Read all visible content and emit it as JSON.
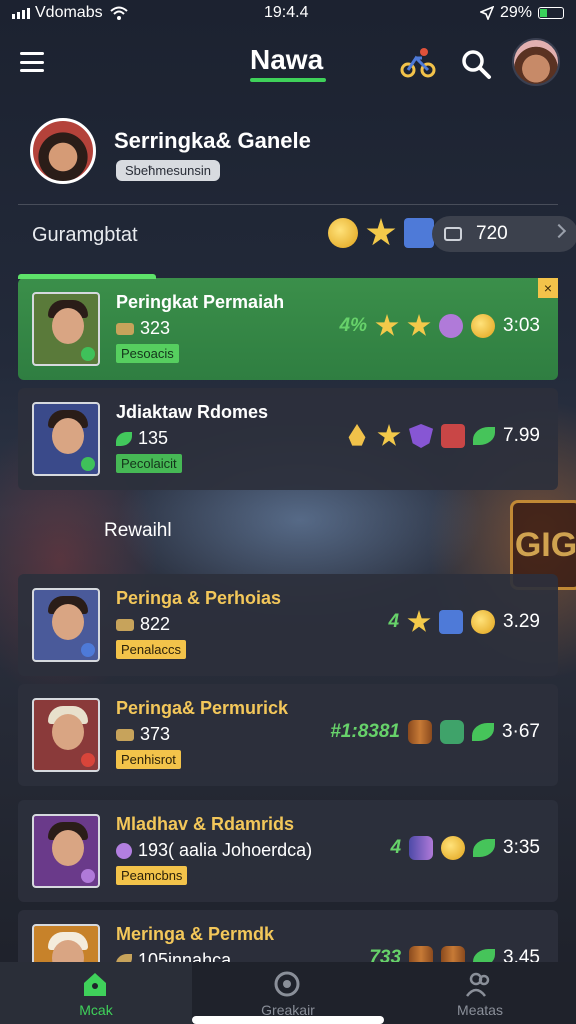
{
  "status_bar": {
    "carrier": "Vdomabs",
    "time": "19:4.4",
    "battery": "29%"
  },
  "header": {
    "title": "Nawa"
  },
  "profile": {
    "name": "Serringka& Ganele",
    "tag": "Sbeħmesunsin",
    "section_label": "Guramgbtat",
    "points": "720"
  },
  "rows_top": [
    {
      "name": "Peringkat Permaiah",
      "count": "323",
      "tag": "Pesoacis",
      "lead": "4%",
      "score": "3:03"
    },
    {
      "name": "Jdiaktaw Rdomes",
      "count": "135",
      "tag": "Pecolaicit",
      "lead": "",
      "score": "7.99"
    }
  ],
  "section_divider": "Rewaihl",
  "rows_bottom": [
    {
      "name": "Peringa & Perhoias",
      "count": "822",
      "tag": "Penalaccs",
      "lead": "4",
      "score": "3.29"
    },
    {
      "name": "Peringa& Permurick",
      "count": "373",
      "tag": "Penhisrot",
      "lead": "#1:8381",
      "score": "3·67"
    },
    {
      "name": "Mladhav & Rdamrids",
      "count": "193( aalia Johoerdca)",
      "tag": "Peamcbns",
      "lead": "4",
      "score": "3:35"
    },
    {
      "name": "Meringa & Permdk",
      "count": "105innahca",
      "tag": "",
      "lead": "733",
      "score": "3.45"
    }
  ],
  "bottom_nav": [
    {
      "label": "Mcak",
      "icon": "home-icon",
      "active": true
    },
    {
      "label": "Greakair",
      "icon": "gear-icon",
      "active": false
    },
    {
      "label": "Meatas",
      "icon": "people-icon",
      "active": false
    }
  ],
  "colors": {
    "accent": "#3fd15a",
    "gold": "#f3c34a",
    "card": "#2c303c"
  }
}
